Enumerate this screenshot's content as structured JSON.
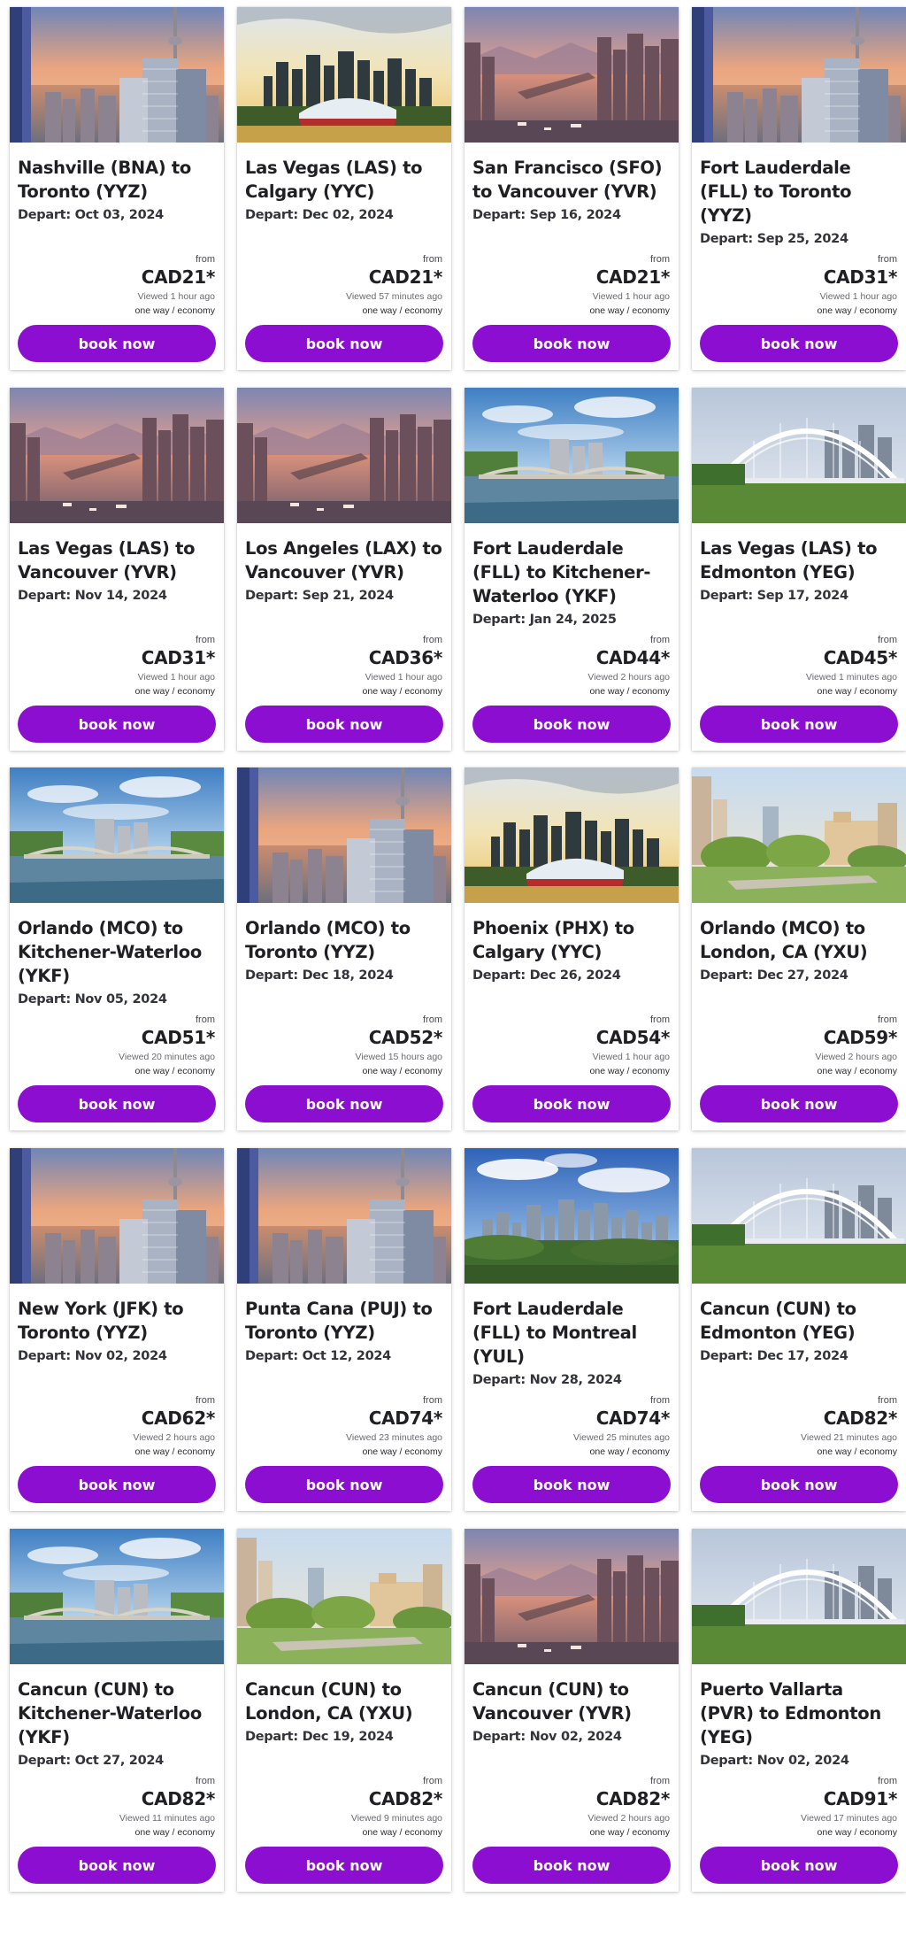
{
  "colors": {
    "accent": "#8c0fd1",
    "text": "#1f1f24"
  },
  "cards": [
    {
      "route": "Nashville (BNA) to Toronto (YYZ)",
      "depart": "Depart: Oct 03, 2024",
      "from": "from",
      "price": "CAD21*",
      "viewed": "Viewed 1 hour ago",
      "fare": "one way / economy",
      "button": "book now",
      "image": "toronto-skyline"
    },
    {
      "route": "Las Vegas (LAS) to Calgary (YYC)",
      "depart": "Depart: Dec 02, 2024",
      "from": "from",
      "price": "CAD21*",
      "viewed": "Viewed 57 minutes ago",
      "fare": "one way / economy",
      "button": "book now",
      "image": "calgary-skyline"
    },
    {
      "route": "San Francisco (SFO) to Vancouver (YVR)",
      "depart": "Depart: Sep 16, 2024",
      "from": "from",
      "price": "CAD21*",
      "viewed": "Viewed 1 hour ago",
      "fare": "one way / economy",
      "button": "book now",
      "image": "vancouver-sunset"
    },
    {
      "route": "Fort Lauderdale (FLL) to Toronto (YYZ)",
      "depart": "Depart: Sep 25, 2024",
      "from": "from",
      "price": "CAD31*",
      "viewed": "Viewed 1 hour ago",
      "fare": "one way / economy",
      "button": "book now",
      "image": "toronto-skyline"
    },
    {
      "route": "Las Vegas (LAS) to Vancouver (YVR)",
      "depart": "Depart: Nov 14, 2024",
      "from": "from",
      "price": "CAD31*",
      "viewed": "Viewed 1 hour ago",
      "fare": "one way / economy",
      "button": "book now",
      "image": "vancouver-sunset"
    },
    {
      "route": "Los Angeles (LAX) to Vancouver (YVR)",
      "depart": "Depart: Sep 21, 2024",
      "from": "from",
      "price": "CAD36*",
      "viewed": "Viewed 1 hour ago",
      "fare": "one way / economy",
      "button": "book now",
      "image": "vancouver-sunset"
    },
    {
      "route": "Fort Lauderdale (FLL) to Kitchener-Waterloo (YKF)",
      "depart": "Depart: Jan 24, 2025",
      "from": "from",
      "price": "CAD44*",
      "viewed": "Viewed 2 hours ago",
      "fare": "one way / economy",
      "button": "book now",
      "image": "waterloo-bridge"
    },
    {
      "route": "Las Vegas (LAS) to Edmonton (YEG)",
      "depart": "Depart: Sep 17, 2024",
      "from": "from",
      "price": "CAD45*",
      "viewed": "Viewed 1 minutes ago",
      "fare": "one way / economy",
      "button": "book now",
      "image": "edmonton-bridge"
    },
    {
      "route": "Orlando (MCO) to Kitchener-Waterloo (YKF)",
      "depart": "Depart: Nov 05, 2024",
      "from": "from",
      "price": "CAD51*",
      "viewed": "Viewed 20 minutes ago",
      "fare": "one way / economy",
      "button": "book now",
      "image": "waterloo-bridge"
    },
    {
      "route": "Orlando (MCO) to Toronto (YYZ)",
      "depart": "Depart: Dec 18, 2024",
      "from": "from",
      "price": "CAD52*",
      "viewed": "Viewed 15 hours ago",
      "fare": "one way / economy",
      "button": "book now",
      "image": "toronto-skyline"
    },
    {
      "route": "Phoenix (PHX) to Calgary (YYC)",
      "depart": "Depart: Dec 26, 2024",
      "from": "from",
      "price": "CAD54*",
      "viewed": "Viewed 1 hour ago",
      "fare": "one way / economy",
      "button": "book now",
      "image": "calgary-skyline"
    },
    {
      "route": "Orlando (MCO) to London, CA (YXU)",
      "depart": "Depart: Dec 27, 2024",
      "from": "from",
      "price": "CAD59*",
      "viewed": "Viewed 2 hours ago",
      "fare": "one way / economy",
      "button": "book now",
      "image": "london-park"
    },
    {
      "route": "New York (JFK) to Toronto (YYZ)",
      "depart": "Depart: Nov 02, 2024",
      "from": "from",
      "price": "CAD62*",
      "viewed": "Viewed 2 hours ago",
      "fare": "one way / economy",
      "button": "book now",
      "image": "toronto-skyline"
    },
    {
      "route": "Punta Cana (PUJ) to Toronto (YYZ)",
      "depart": "Depart: Oct 12, 2024",
      "from": "from",
      "price": "CAD74*",
      "viewed": "Viewed 23 minutes ago",
      "fare": "one way / economy",
      "button": "book now",
      "image": "toronto-skyline"
    },
    {
      "route": "Fort Lauderdale (FLL) to Montreal (YUL)",
      "depart": "Depart: Nov 28, 2024",
      "from": "from",
      "price": "CAD74*",
      "viewed": "Viewed 25 minutes ago",
      "fare": "one way / economy",
      "button": "book now",
      "image": "montreal-skyline"
    },
    {
      "route": "Cancun (CUN) to Edmonton (YEG)",
      "depart": "Depart: Dec 17, 2024",
      "from": "from",
      "price": "CAD82*",
      "viewed": "Viewed 21 minutes ago",
      "fare": "one way / economy",
      "button": "book now",
      "image": "edmonton-bridge"
    },
    {
      "route": "Cancun (CUN) to Kitchener-Waterloo (YKF)",
      "depart": "Depart: Oct 27, 2024",
      "from": "from",
      "price": "CAD82*",
      "viewed": "Viewed 11 minutes ago",
      "fare": "one way / economy",
      "button": "book now",
      "image": "waterloo-bridge"
    },
    {
      "route": "Cancun (CUN) to London, CA (YXU)",
      "depart": "Depart: Dec 19, 2024",
      "from": "from",
      "price": "CAD82*",
      "viewed": "Viewed 9 minutes ago",
      "fare": "one way / economy",
      "button": "book now",
      "image": "london-park"
    },
    {
      "route": "Cancun (CUN) to Vancouver (YVR)",
      "depart": "Depart: Nov 02, 2024",
      "from": "from",
      "price": "CAD82*",
      "viewed": "Viewed 2 hours ago",
      "fare": "one way / economy",
      "button": "book now",
      "image": "vancouver-sunset"
    },
    {
      "route": "Puerto Vallarta (PVR) to Edmonton (YEG)",
      "depart": "Depart: Nov 02, 2024",
      "from": "from",
      "price": "CAD91*",
      "viewed": "Viewed 17 minutes ago",
      "fare": "one way / economy",
      "button": "book now",
      "image": "edmonton-bridge"
    }
  ]
}
